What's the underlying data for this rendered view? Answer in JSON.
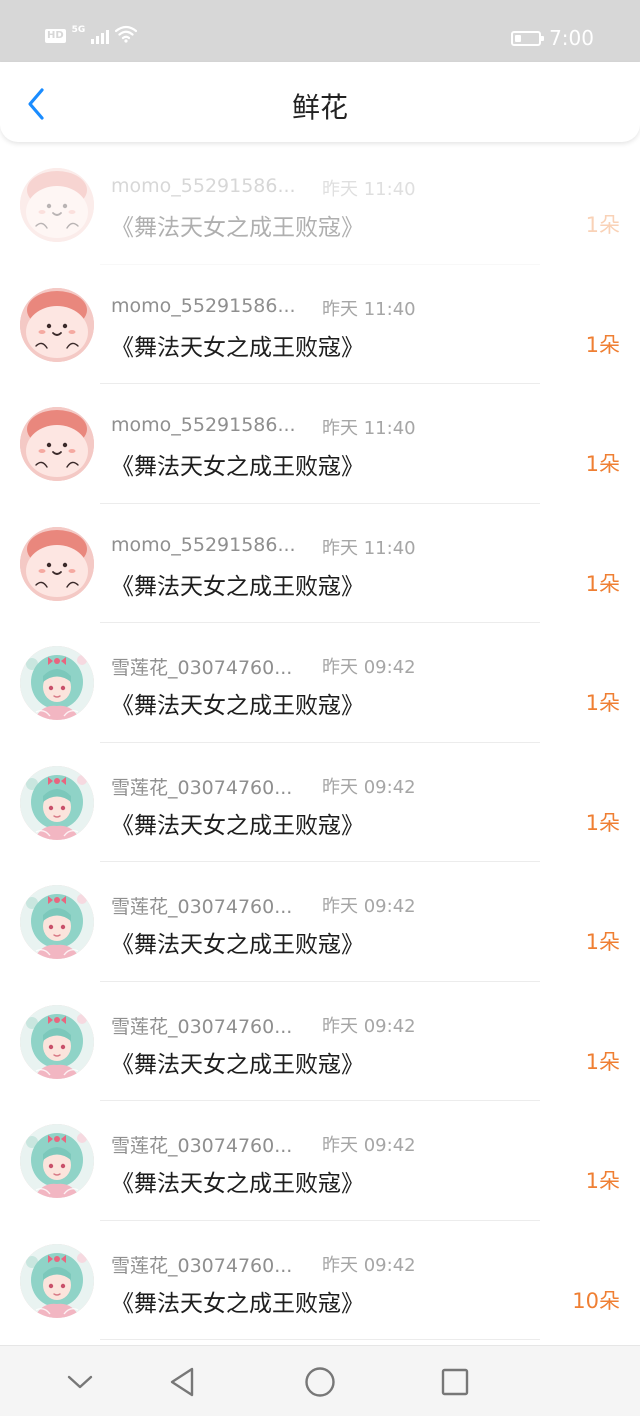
{
  "status_bar": {
    "hd": "HD",
    "network": "5G",
    "time": "7:00"
  },
  "header": {
    "title": "鲜花"
  },
  "icons": {
    "back": "chevron-left-icon",
    "battery": "battery-icon",
    "wifi": "wifi-icon",
    "signal": "signal-icon",
    "nav_collapse": "chevron-down-icon",
    "nav_back": "triangle-back-icon",
    "nav_home": "circle-home-icon",
    "nav_recent": "square-recent-icon"
  },
  "colors": {
    "accent_blue": "#1a8cff",
    "count_orange": "#ef7f33",
    "status_bar_bg": "#d7d7d7"
  },
  "flowers": [
    {
      "avatar": "pink-mascot",
      "user": "momo_55291586...",
      "time": "昨天 11:40",
      "title": "《舞法天女之成王败寇》",
      "count": "1朵",
      "faded": true
    },
    {
      "avatar": "pink-mascot",
      "user": "momo_55291586...",
      "time": "昨天 11:40",
      "title": "《舞法天女之成王败寇》",
      "count": "1朵",
      "faded": false
    },
    {
      "avatar": "pink-mascot",
      "user": "momo_55291586...",
      "time": "昨天 11:40",
      "title": "《舞法天女之成王败寇》",
      "count": "1朵",
      "faded": false
    },
    {
      "avatar": "pink-mascot",
      "user": "momo_55291586...",
      "time": "昨天 11:40",
      "title": "《舞法天女之成王败寇》",
      "count": "1朵",
      "faded": false
    },
    {
      "avatar": "anime-girl",
      "user": "雪莲花_03074760...",
      "time": "昨天 09:42",
      "title": "《舞法天女之成王败寇》",
      "count": "1朵",
      "faded": false
    },
    {
      "avatar": "anime-girl",
      "user": "雪莲花_03074760...",
      "time": "昨天 09:42",
      "title": "《舞法天女之成王败寇》",
      "count": "1朵",
      "faded": false
    },
    {
      "avatar": "anime-girl",
      "user": "雪莲花_03074760...",
      "time": "昨天 09:42",
      "title": "《舞法天女之成王败寇》",
      "count": "1朵",
      "faded": false
    },
    {
      "avatar": "anime-girl",
      "user": "雪莲花_03074760...",
      "time": "昨天 09:42",
      "title": "《舞法天女之成王败寇》",
      "count": "1朵",
      "faded": false
    },
    {
      "avatar": "anime-girl",
      "user": "雪莲花_03074760...",
      "time": "昨天 09:42",
      "title": "《舞法天女之成王败寇》",
      "count": "1朵",
      "faded": false
    },
    {
      "avatar": "anime-girl",
      "user": "雪莲花_03074760...",
      "time": "昨天 09:42",
      "title": "《舞法天女之成王败寇》",
      "count": "10朵",
      "faded": false
    }
  ]
}
